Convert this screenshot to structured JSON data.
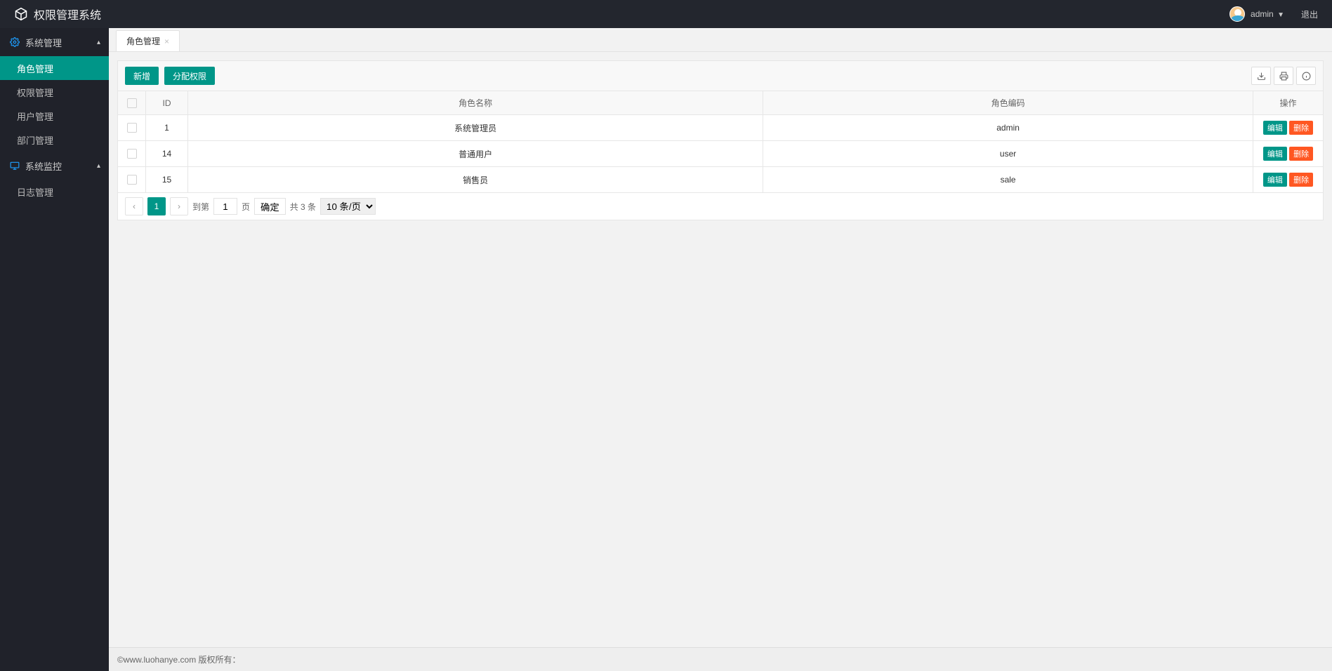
{
  "header": {
    "title": "权限管理系统",
    "username": "admin",
    "logout": "退出"
  },
  "sidebar": {
    "groups": [
      {
        "title": "系统管理",
        "icon": "gear",
        "items": [
          {
            "label": "角色管理",
            "active": true
          },
          {
            "label": "权限管理",
            "active": false
          },
          {
            "label": "用户管理",
            "active": false
          },
          {
            "label": "部门管理",
            "active": false
          }
        ]
      },
      {
        "title": "系统监控",
        "icon": "monitor",
        "items": [
          {
            "label": "日志管理",
            "active": false
          }
        ]
      }
    ]
  },
  "tabs": [
    {
      "label": "角色管理"
    }
  ],
  "toolbar": {
    "add": "新增",
    "assign": "分配权限"
  },
  "table": {
    "headers": {
      "id": "ID",
      "name": "角色名称",
      "code": "角色编码",
      "action": "操作"
    },
    "rows": [
      {
        "id": "1",
        "name": "系统管理员",
        "code": "admin"
      },
      {
        "id": "14",
        "name": "普通用户",
        "code": "user"
      },
      {
        "id": "15",
        "name": "销售员",
        "code": "sale"
      }
    ],
    "edit": "编辑",
    "delete": "删除"
  },
  "pager": {
    "goto_label": "到第",
    "page_suffix": "页",
    "current_input": "1",
    "confirm": "确定",
    "total": "共 3 条",
    "page_size": "10 条/页"
  },
  "footer": {
    "copyright": "©www.luohanye.com 版权所有："
  }
}
